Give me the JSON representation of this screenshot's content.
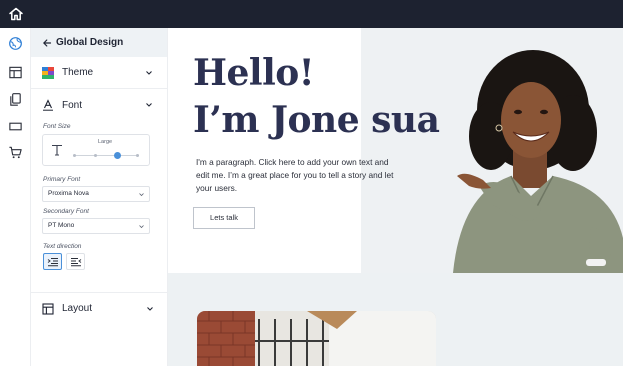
{
  "sidebar": {
    "title": "Global Design",
    "sections": {
      "theme": "Theme",
      "font": "Font",
      "layout": "Layout"
    },
    "font": {
      "size_label": "Font Size",
      "size_value": "Large",
      "primary_label": "Primary Font",
      "primary_value": "Proxima Nova",
      "secondary_label": "Secondary Font",
      "secondary_value": "PT Mono",
      "direction_label": "Text direction"
    }
  },
  "canvas": {
    "headline_line1": "Hello!",
    "headline_line2": "I’m Jone sua",
    "paragraph": "I'm a paragraph. Click here to add your own text and edit me. I’m a great place for you to tell a story and let your users.",
    "cta_label": "Lets talk"
  },
  "colors": {
    "topbar": "#1d2230",
    "accent": "#4a90d9",
    "headline": "#2c3152"
  },
  "icons": [
    "home-icon",
    "globe-palette-icon",
    "layout-icon",
    "pages-icon",
    "rectangle-icon",
    "cart-icon",
    "arrow-left-icon",
    "palette-icon",
    "font-icon",
    "chevron-down-icon",
    "text-size-icon",
    "align-right-icon",
    "align-left-icon"
  ]
}
